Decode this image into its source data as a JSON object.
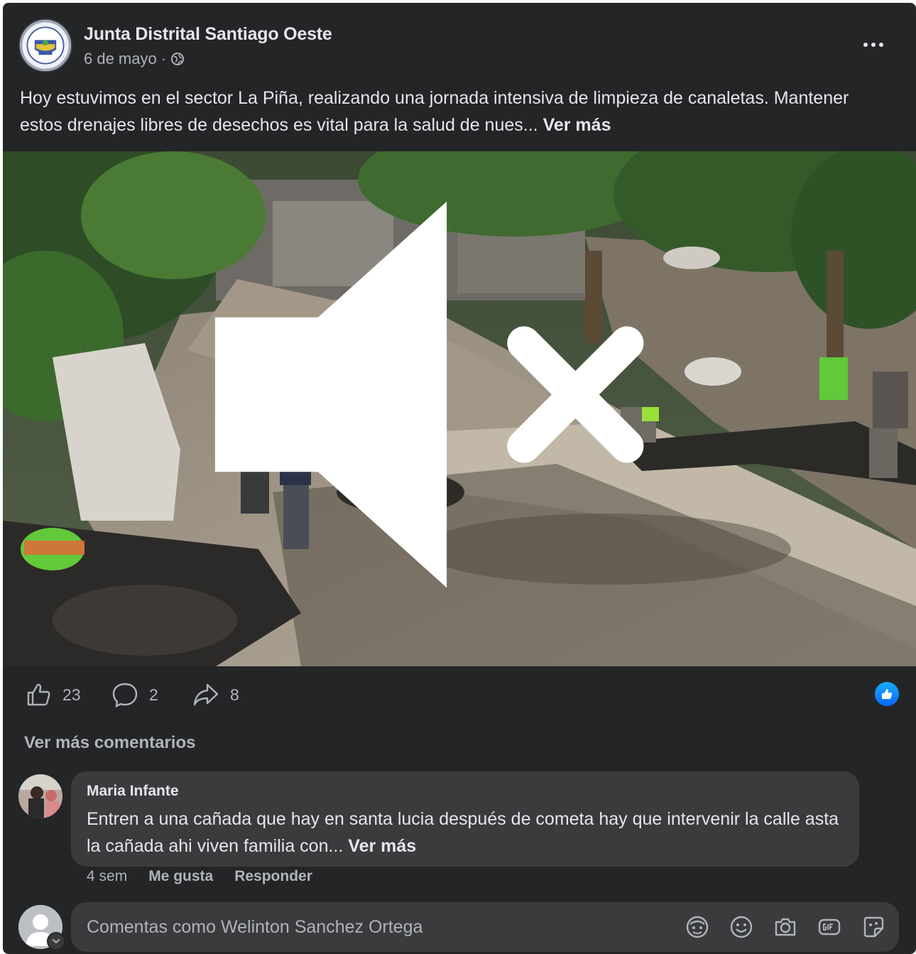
{
  "post": {
    "page_name": "Junta Distrital Santiago Oeste",
    "date": "6 de mayo",
    "separator": "·",
    "text": "Hoy estuvimos en el sector La Piña, realizando una jornada intensiva de limpieza de canaletas. Mantener estos drenajes libres de desechos es vital para la salud de nues...",
    "see_more": "Ver más",
    "avatar_icon": "municipal-seal-icon",
    "audience_icon": "globe-icon"
  },
  "video": {
    "muted": true,
    "mute_icon": "speaker-muted-icon"
  },
  "actions": {
    "likes": "23",
    "comments": "2",
    "shares": "8",
    "like_icon": "thumbs-up-icon",
    "comment_icon": "comment-bubble-icon",
    "share_icon": "share-arrow-icon",
    "reaction_icon": "like-reaction-badge-icon"
  },
  "comments": {
    "view_more": "Ver más comentarios",
    "items": [
      {
        "author": "Maria Infante",
        "text": "Entren a una cañada que hay en santa lucia después de cometa hay que intervenir la calle asta la cañada ahi viven familia con...",
        "see_more": "Ver más",
        "time": "4 sem",
        "like_label": "Me gusta",
        "reply_label": "Responder"
      }
    ]
  },
  "composer": {
    "placeholder": "Comentas como Welinton Sanchez Ortega",
    "tools": [
      "avatar-sticker-icon",
      "emoji-icon",
      "camera-icon",
      "gif-icon",
      "sticker-icon"
    ]
  },
  "colors": {
    "card_bg": "#242526",
    "bubble_bg": "#3a3b3c",
    "primary_text": "#e4e6eb",
    "secondary_text": "#b0b3b8",
    "like_blue": "#0866ff"
  }
}
